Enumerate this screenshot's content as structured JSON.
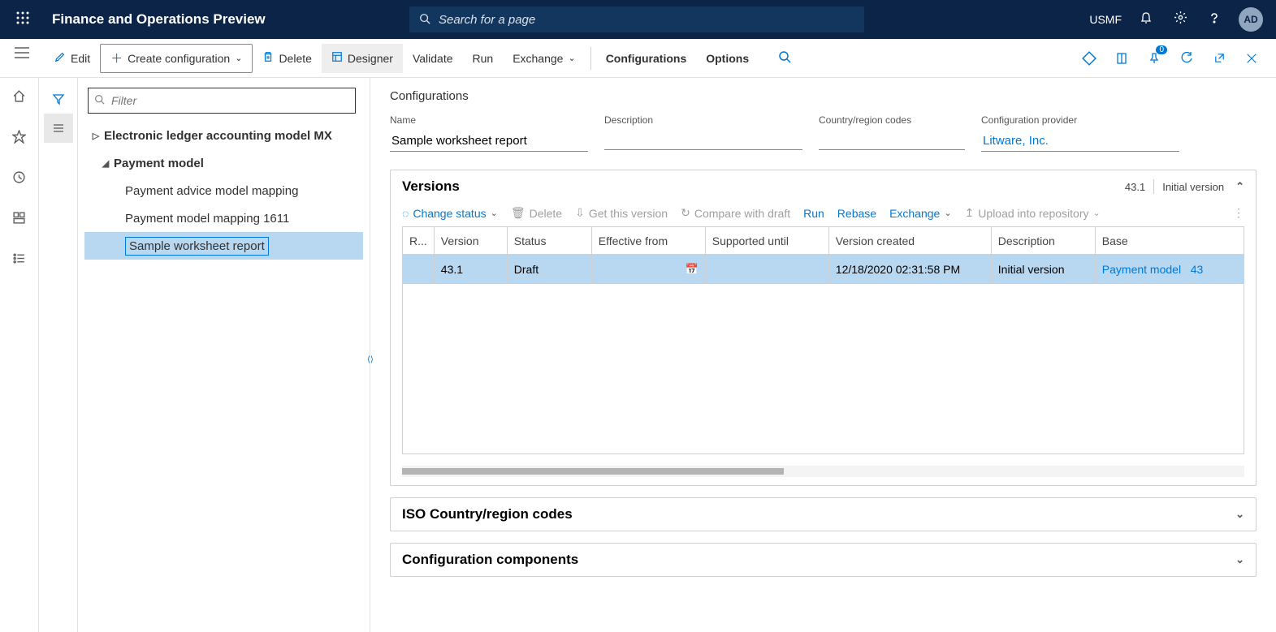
{
  "topbar": {
    "app_title": "Finance and Operations Preview",
    "search_placeholder": "Search for a page",
    "company": "USMF",
    "avatar": "AD"
  },
  "actionbar": {
    "edit": "Edit",
    "create_config": "Create configuration",
    "delete": "Delete",
    "designer": "Designer",
    "validate": "Validate",
    "run": "Run",
    "exchange": "Exchange",
    "configurations": "Configurations",
    "options": "Options",
    "badge_count": "0"
  },
  "filter_placeholder": "Filter",
  "tree": {
    "item0": "Electronic ledger accounting model MX",
    "item1": "Payment model",
    "item2": "Payment advice model mapping",
    "item3": "Payment model mapping 1611",
    "item4": "Sample worksheet report"
  },
  "breadcrumb": "Configurations",
  "fields": {
    "name_label": "Name",
    "name_value": "Sample worksheet report",
    "desc_label": "Description",
    "desc_value": "",
    "country_label": "Country/region codes",
    "country_value": "",
    "provider_label": "Configuration provider",
    "provider_value": "Litware, Inc."
  },
  "versions": {
    "title": "Versions",
    "header_meta_num": "43.1",
    "header_meta_text": "Initial version",
    "toolbar": {
      "change_status": "Change status",
      "delete": "Delete",
      "get_version": "Get this version",
      "compare": "Compare with draft",
      "run": "Run",
      "rebase": "Rebase",
      "exchange": "Exchange",
      "upload": "Upload into repository"
    },
    "columns": {
      "r": "R...",
      "version": "Version",
      "status": "Status",
      "effective": "Effective from",
      "supported": "Supported until",
      "created": "Version created",
      "description": "Description",
      "base": "Base"
    },
    "row": {
      "version": "43.1",
      "status": "Draft",
      "effective": "",
      "supported": "",
      "created": "12/18/2020 02:31:58 PM",
      "description": "Initial version",
      "base": "Payment model",
      "base_num": "43"
    }
  },
  "iso_section": "ISO Country/region codes",
  "components_section": "Configuration components"
}
